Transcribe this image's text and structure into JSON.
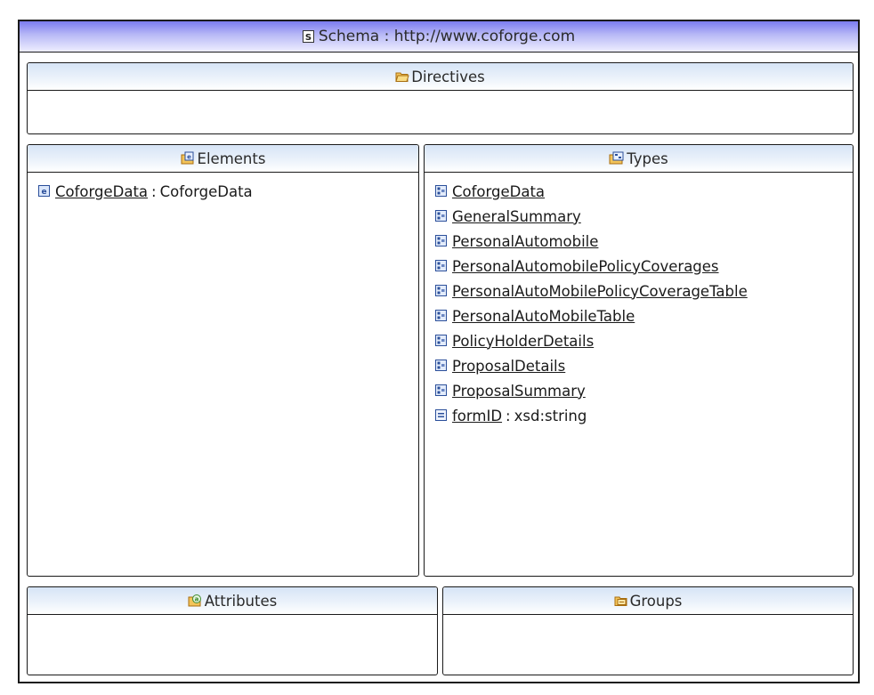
{
  "schema": {
    "title": "Schema : http://www.coforge.com",
    "icon": "schema-icon"
  },
  "directives": {
    "title": "Directives",
    "icon": "folder-open-icon"
  },
  "elements": {
    "title": "Elements",
    "icon": "elements-folder-icon",
    "items": [
      {
        "name": "CoforgeData",
        "separator": ":",
        "type": "CoforgeData",
        "icon": "element-icon"
      }
    ]
  },
  "types": {
    "title": "Types",
    "icon": "types-folder-icon",
    "items": [
      {
        "name": "CoforgeData",
        "icon": "complex-type-icon"
      },
      {
        "name": "GeneralSummary",
        "icon": "complex-type-icon"
      },
      {
        "name": "PersonalAutomobile",
        "icon": "complex-type-icon"
      },
      {
        "name": "PersonalAutomobilePolicyCoverages",
        "icon": "complex-type-icon"
      },
      {
        "name": "PersonalAutoMobilePolicyCoverageTable",
        "icon": "complex-type-icon"
      },
      {
        "name": "PersonalAutoMobileTable",
        "icon": "complex-type-icon"
      },
      {
        "name": "PolicyHolderDetails",
        "icon": "complex-type-icon"
      },
      {
        "name": "ProposalDetails",
        "icon": "complex-type-icon"
      },
      {
        "name": "ProposalSummary",
        "icon": "complex-type-icon"
      },
      {
        "name": "formID",
        "separator": ":",
        "type": "xsd:string",
        "icon": "simple-type-icon"
      }
    ]
  },
  "attributes": {
    "title": "Attributes",
    "icon": "attributes-folder-icon"
  },
  "groups": {
    "title": "Groups",
    "icon": "groups-folder-icon"
  }
}
